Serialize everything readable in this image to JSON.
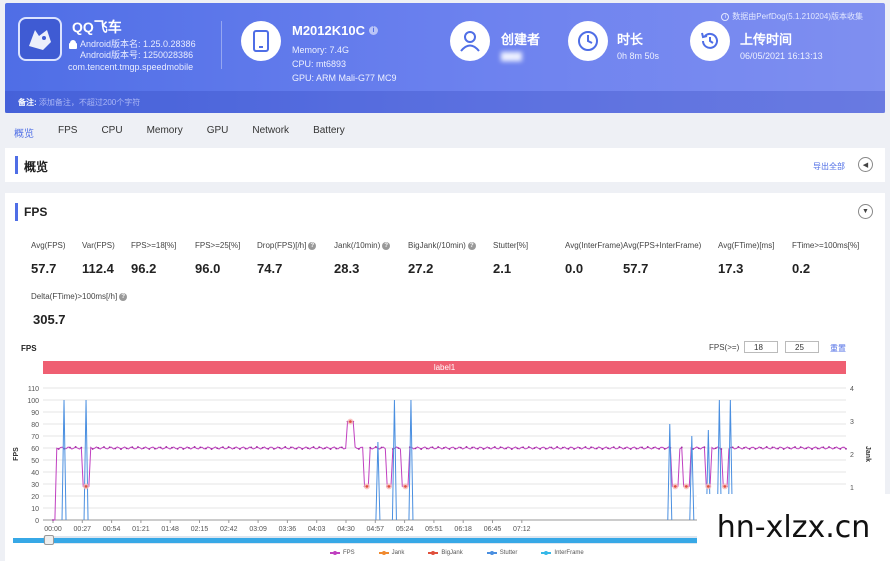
{
  "header": {
    "app_title": "QQ飞车",
    "android_version_name": "Android版本名: 1.25.0.28386",
    "android_version_code": "Android版本号: 1250028386",
    "package": "com.tencent.tmgp.speedmobile",
    "device_name": "M2012K10C",
    "memory": "Memory: 7.4G",
    "cpu": "CPU: mt6893",
    "gpu": "GPU: ARM Mali-G77 MC9",
    "creator_title": "创建者",
    "creator_value": "▇▇▇",
    "duration_title": "时长",
    "duration_value": "0h 8m 50s",
    "upload_title": "上传时间",
    "upload_value": "06/05/2021 16:13:13",
    "source_note": "数据由PerfDog(5.1.210204)版本收集",
    "note_label": "备注:",
    "note_placeholder": "添加备注，不超过200个字符"
  },
  "tabs": [
    "概览",
    "FPS",
    "CPU",
    "Memory",
    "GPU",
    "Network",
    "Battery"
  ],
  "overview": {
    "title": "概览",
    "export": "导出全部"
  },
  "fps_panel": {
    "title": "FPS",
    "metrics": [
      {
        "label": "Avg(FPS)",
        "value": "57.7",
        "help": false
      },
      {
        "label": "Var(FPS)",
        "value": "112.4",
        "help": false
      },
      {
        "label": "FPS>=18[%]",
        "value": "96.2",
        "help": false
      },
      {
        "label": "FPS>=25[%]",
        "value": "96.0",
        "help": false
      },
      {
        "label": "Drop(FPS)[/h]",
        "value": "74.7",
        "help": true
      },
      {
        "label": "Jank(/10min)",
        "value": "28.3",
        "help": true
      },
      {
        "label": "BigJank(/10min)",
        "value": "27.2",
        "help": true
      },
      {
        "label": "Stutter[%]",
        "value": "2.1",
        "help": false
      },
      {
        "label": "Avg(InterFrame)",
        "value": "0.0",
        "help": false
      },
      {
        "label": "Avg(FPS+InterFrame)",
        "value": "57.7",
        "help": false
      },
      {
        "label": "Avg(FTime)[ms]",
        "value": "17.3",
        "help": false
      },
      {
        "label": "FTime>=100ms[%]",
        "value": "0.2",
        "help": false
      },
      {
        "label": "Delta(FTime)>100ms[/h]",
        "value": "305.7",
        "help": true
      }
    ],
    "help_glyph": "?",
    "chart_label": "FPS",
    "threshold_label": "FPS(>=)",
    "threshold_1": "18",
    "threshold_2": "25",
    "reset": "重置",
    "label_bar": "label1"
  },
  "colors": {
    "accent": "#4f6ee6",
    "fps": "#c040c0",
    "jank": "#f08a30",
    "bigjank": "#e0503c",
    "stutter": "#4a8fe0",
    "interframe": "#35b8e8"
  },
  "chart_data": {
    "type": "line",
    "x_ticks": [
      "00:00",
      "00:27",
      "00:54",
      "01:21",
      "01:48",
      "02:15",
      "02:42",
      "03:09",
      "03:36",
      "04:03",
      "04:30",
      "04:57",
      "05:24",
      "05:51",
      "06:18",
      "06:45",
      "07:12"
    ],
    "y_left_ticks": [
      "0",
      "10",
      "20",
      "30",
      "40",
      "50",
      "60",
      "70",
      "80",
      "90",
      "100",
      "110"
    ],
    "y_right_ticks": [
      "0",
      "1",
      "2",
      "3",
      "4"
    ],
    "ylabel_left": "FPS",
    "ylabel_right": "Jank",
    "ylim": [
      0,
      110
    ],
    "y2lim": [
      0,
      4
    ],
    "series": [
      {
        "name": "FPS",
        "baseline": 60,
        "dips": [
          [
            0.3,
            28
          ],
          [
            2.7,
            82
          ],
          [
            2.85,
            28
          ],
          [
            3.05,
            28
          ],
          [
            3.2,
            28
          ],
          [
            5.65,
            28
          ],
          [
            5.75,
            28
          ],
          [
            5.95,
            28
          ],
          [
            6.1,
            28
          ]
        ]
      },
      {
        "name": "Jank",
        "values": []
      },
      {
        "name": "BigJank",
        "values": []
      },
      {
        "name": "Stutter",
        "spikes": [
          [
            0.1,
            100
          ],
          [
            0.3,
            100
          ],
          [
            2.95,
            65
          ],
          [
            3.1,
            100
          ],
          [
            3.25,
            100
          ],
          [
            5.6,
            80
          ],
          [
            5.8,
            70
          ],
          [
            5.95,
            75
          ],
          [
            6.05,
            100
          ],
          [
            6.15,
            100
          ]
        ]
      },
      {
        "name": "InterFrame",
        "values": []
      }
    ]
  }
}
